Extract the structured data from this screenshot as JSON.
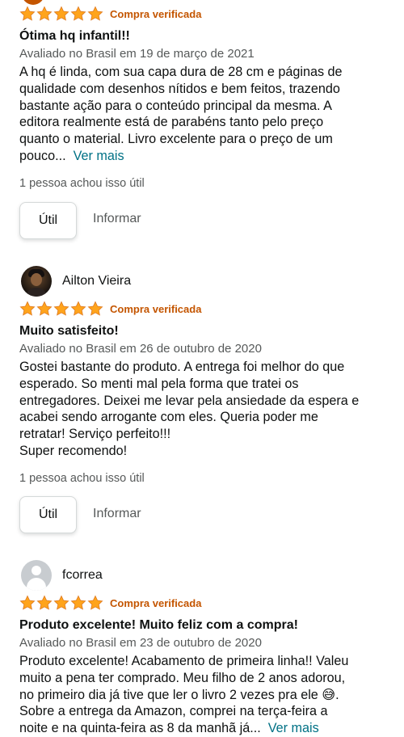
{
  "reviews": [
    {
      "user": "",
      "verified": "Compra verificada",
      "stars": 5,
      "title": "Ótima hq infantil!!",
      "date": "Avaliado no Brasil em 19 de março de 2021",
      "lines": [
        "A hq é linda, com sua capa dura de 28 cm e páginas de",
        "qualidade com desenhos nítidos e bem feitos, trazendo",
        "bastante ação para o conteúdo principal da mesma. A",
        "editora realmente está de parabéns tanto pelo preço",
        "quanto o material. Livro excelente para o preço de um",
        "pouco..."
      ],
      "see_more": "Ver mais",
      "helpful": "1 pessoa achou isso útil",
      "useful_label": "Útil",
      "report_label": "Informar"
    },
    {
      "user": "Ailton Vieira",
      "verified": "Compra verificada",
      "stars": 5,
      "title": "Muito satisfeito!",
      "date": "Avaliado no Brasil em 26 de outubro de 2020",
      "lines": [
        "Gostei bastante do produto. A entrega foi melhor do que",
        "esperado. So menti mal pela forma que tratei os",
        "entregadores. Deixei me levar pela ansiedade da espera e",
        "acabei sendo arrogante com eles. Queria poder me",
        "retratar! Serviço perfeito!!!",
        "Super recomendo!"
      ],
      "helpful": "1 pessoa achou isso útil",
      "useful_label": "Útil",
      "report_label": "Informar"
    },
    {
      "user": "fcorrea",
      "verified": "Compra verificada",
      "stars": 5,
      "title": "Produto excelente! Muito feliz com a compra!",
      "date": "Avaliado no Brasil em 23 de outubro de 2020",
      "lines": [
        "Produto excelente! Acabamento de primeira linha!! Valeu",
        "muito a pena ter comprado. Meu filho de 2 anos adorou,",
        "no primeiro dia já tive que ler o livro 2 vezes pra ele 😅.",
        "Sobre a entrega da Amazon, comprei na terça-feira a",
        "noite e na quinta-feira as 8 da manhã já..."
      ],
      "see_more": "Ver mais"
    }
  ],
  "colors": {
    "star": "#ffa41c",
    "verified": "#c45500",
    "link": "#007185",
    "muted": "#565959"
  }
}
